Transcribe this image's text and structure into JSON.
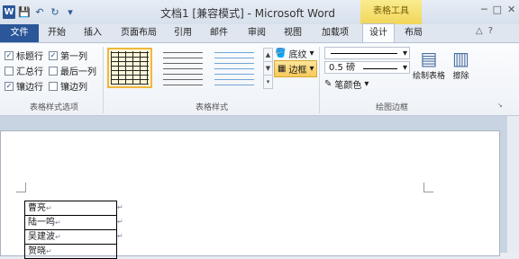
{
  "window": {
    "title": "文档1 [兼容模式] - Microsoft Word",
    "context_group": "表格工具",
    "app_icon_letter": "W",
    "minimize": "─",
    "maximize": "□",
    "close": "✕"
  },
  "qat": {
    "save": "💾",
    "undo": "↶",
    "redo": "↻",
    "customize": "▾"
  },
  "tabs": [
    "文件",
    "开始",
    "插入",
    "页面布局",
    "引用",
    "邮件",
    "审阅",
    "视图",
    "加载项",
    "设计",
    "布局"
  ],
  "ribbon_controls": {
    "minimize": "△",
    "help": "?"
  },
  "style_options": {
    "items": [
      {
        "label": "标题行",
        "checked": true
      },
      {
        "label": "第一列",
        "checked": true
      },
      {
        "label": "汇总行",
        "checked": false
      },
      {
        "label": "最后一列",
        "checked": false
      },
      {
        "label": "镶边行",
        "checked": true
      },
      {
        "label": "镶边列",
        "checked": false
      }
    ],
    "group_label": "表格样式选项"
  },
  "table_styles": {
    "group_label": "表格样式",
    "shading_label": "底纹",
    "border_label": "边框"
  },
  "draw_borders": {
    "group_label": "绘图边框",
    "line_weight": "0.5 磅",
    "pen_color_label": "笔颜色",
    "draw_table_label": "绘制表格",
    "eraser_label": "擦除"
  },
  "document": {
    "rows": [
      "曹亮",
      "陆一鸣",
      "吴建波",
      "贺晓"
    ]
  },
  "colors": {
    "file_tab": "#2b579a",
    "context": "#f1d65a"
  }
}
